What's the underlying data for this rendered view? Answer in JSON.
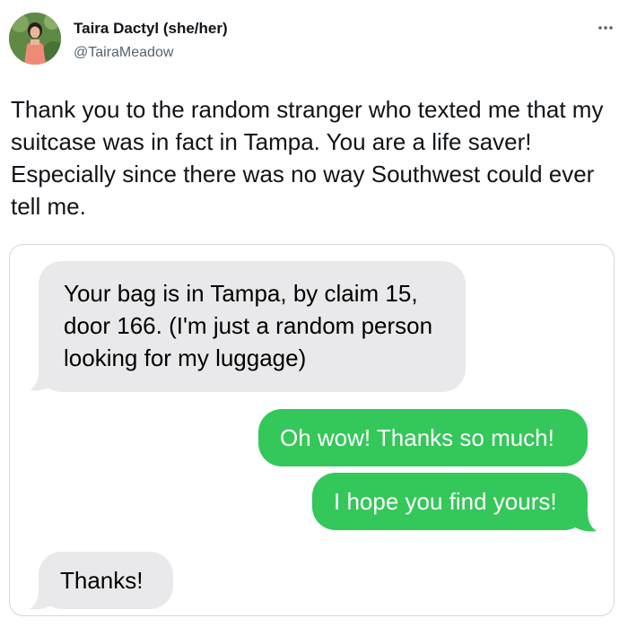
{
  "author": {
    "name": "Taira Dactyl (she/her)",
    "handle": "@TairaMeadow",
    "avatar_icon": "profile-photo"
  },
  "menu": {
    "more_icon": "more-horizontal-icon"
  },
  "tweet": {
    "text": "Thank you to the random stranger who texted me that my suitcase was in fact in Tampa. You are a life saver! Especially since there was no way Southwest could ever tell me."
  },
  "conversation": {
    "colors": {
      "received_bubble": "#e9e9eb",
      "sent_bubble": "#34c759"
    },
    "messages": [
      {
        "direction": "received",
        "text": "Your bag is in Tampa, by claim 15, door 166. (I'm just a random person looking for my luggage)"
      },
      {
        "direction": "sent",
        "text": "Oh wow! Thanks so much!"
      },
      {
        "direction": "sent",
        "text": "I hope you find yours!"
      },
      {
        "direction": "received",
        "text": "Thanks!"
      }
    ]
  }
}
